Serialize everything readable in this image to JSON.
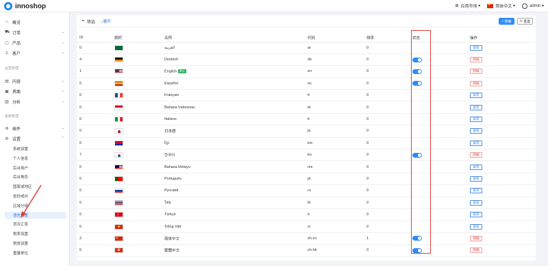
{
  "header": {
    "logo_text": "innoshop",
    "app_market": "应用市场",
    "language": "简体中文",
    "user": "admin"
  },
  "sidebar": {
    "main_items": [
      {
        "label": "概览",
        "icon": "home-icon"
      },
      {
        "label": "订单",
        "icon": "cart-icon"
      },
      {
        "label": "产品",
        "icon": "box-icon"
      },
      {
        "label": "客户",
        "icon": "user-icon"
      }
    ],
    "group_ops": "运营管理",
    "ops_items": [
      {
        "label": "内容",
        "icon": "document-icon"
      },
      {
        "label": "界面",
        "icon": "layout-icon"
      },
      {
        "label": "分析",
        "icon": "chart-icon"
      }
    ],
    "group_sys": "系统管理",
    "sys_items": [
      {
        "label": "插件",
        "icon": "plugin-icon"
      },
      {
        "label": "设置",
        "icon": "gear-icon"
      }
    ],
    "settings_sub": [
      "系统设置",
      "个人信息",
      "后台用户",
      "后台角色",
      "国家或地区",
      "省份或州",
      "区域分组",
      "语言设置",
      "货币汇率",
      "税率设置",
      "税类设置",
      "重量单位"
    ],
    "active_sub": "语言设置"
  },
  "filter": {
    "label": "筛选",
    "expand": "展开",
    "search_btn": "搜索",
    "reset_btn": "重置"
  },
  "table": {
    "columns": [
      "ID",
      "旗帜",
      "名称",
      "代码",
      "排序",
      "状态",
      "操作"
    ],
    "rows": [
      {
        "id": "0",
        "flag": "ar",
        "name": "العربية",
        "code": "ar",
        "sort": "0",
        "enabled": false,
        "action": "安装"
      },
      {
        "id": "4",
        "flag": "de",
        "name": "Deutsch",
        "code": "de",
        "sort": "0",
        "enabled": true,
        "action": "卸载"
      },
      {
        "id": "1",
        "flag": "en",
        "name": "English",
        "badge": "默认",
        "code": "en",
        "sort": "0",
        "enabled": true,
        "action": "卸载"
      },
      {
        "id": "5",
        "flag": "es",
        "name": "Español",
        "code": "es",
        "sort": "0",
        "enabled": true,
        "action": "卸载"
      },
      {
        "id": "0",
        "flag": "fr",
        "name": "Français",
        "code": "fr",
        "sort": "0",
        "enabled": false,
        "action": "安装"
      },
      {
        "id": "0",
        "flag": "id",
        "name": "Bahasa Indonesia",
        "code": "id",
        "sort": "0",
        "enabled": false,
        "action": "安装"
      },
      {
        "id": "0",
        "flag": "it",
        "name": "Italiano",
        "code": "it",
        "sort": "0",
        "enabled": false,
        "action": "安装"
      },
      {
        "id": "0",
        "flag": "ja",
        "name": "日本語",
        "code": "ja",
        "sort": "0",
        "enabled": false,
        "action": "安装"
      },
      {
        "id": "0",
        "flag": "km",
        "name": "ខ្មែរ",
        "code": "km",
        "sort": "0",
        "enabled": false,
        "action": "安装"
      },
      {
        "id": "7",
        "flag": "ko",
        "name": "한국어",
        "code": "ko",
        "sort": "0",
        "enabled": true,
        "action": "卸载"
      },
      {
        "id": "0",
        "flag": "ms",
        "name": "Bahasa Melayu",
        "code": "ms",
        "sort": "0",
        "enabled": false,
        "action": "安装"
      },
      {
        "id": "0",
        "flag": "pt",
        "name": "Português",
        "code": "pt",
        "sort": "0",
        "enabled": false,
        "action": "安装"
      },
      {
        "id": "0",
        "flag": "ru",
        "name": "Русский",
        "code": "ru",
        "sort": "0",
        "enabled": false,
        "action": "安装"
      },
      {
        "id": "0",
        "flag": "th",
        "name": "ไทย",
        "code": "th",
        "sort": "0",
        "enabled": false,
        "action": "安装"
      },
      {
        "id": "0",
        "flag": "tr",
        "name": "Türkçe",
        "code": "tr",
        "sort": "0",
        "enabled": false,
        "action": "安装"
      },
      {
        "id": "0",
        "flag": "vi",
        "name": "Tiếng Việt",
        "code": "vi",
        "sort": "0",
        "enabled": false,
        "action": "安装"
      },
      {
        "id": "2",
        "flag": "zh-cn",
        "name": "简体中文",
        "code": "zh-cn",
        "sort": "1",
        "enabled": true,
        "action": "卸载"
      },
      {
        "id": "6",
        "flag": "zh-hk",
        "name": "繁體中文",
        "code": "zh-hk",
        "sort": "0",
        "enabled": true,
        "action": "卸载"
      }
    ]
  },
  "colors": {
    "accent": "#2f8cf5",
    "danger": "#e53935"
  }
}
